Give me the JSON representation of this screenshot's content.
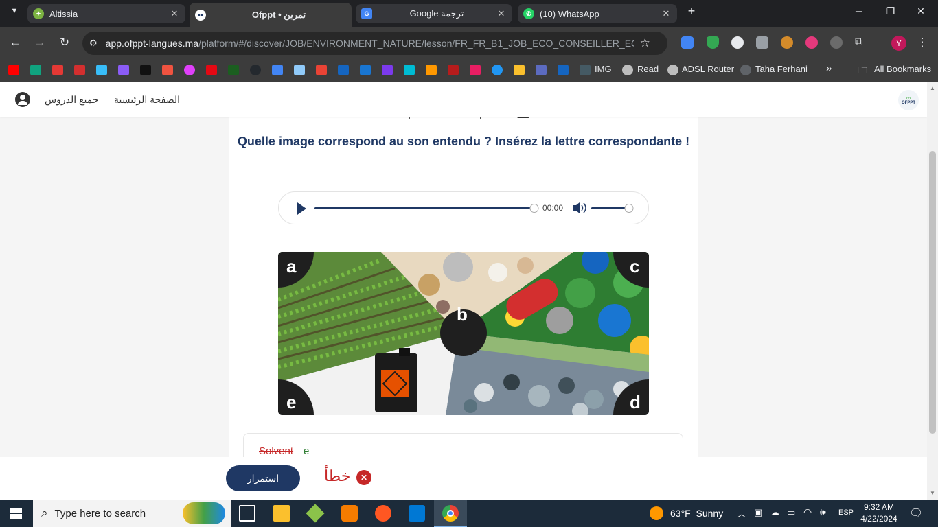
{
  "tabs": [
    {
      "title": "Altissia",
      "active": false
    },
    {
      "title": "Ofppt • تمرين",
      "active": true
    },
    {
      "title": "Google ترجمة",
      "active": false
    },
    {
      "title": "(10) WhatsApp",
      "active": false
    }
  ],
  "toolbar": {
    "url_domain": "app.ofppt-langues.ma",
    "url_path": "/platform/#/discover/JOB/ENVIRONMENT_NATURE/lesson/FR_FR_B1_JOB_ECO_CONSEILLER_ECO_CO..."
  },
  "bookmarks": {
    "labels": [
      "IMG",
      "Read",
      "ADSL Router",
      "Taha Ferhani"
    ],
    "all_bookmarks": "All Bookmarks",
    "more": "»"
  },
  "profile_initial": "Y",
  "site": {
    "nav_all_lessons": "جميع الدروس",
    "nav_home": "الصفحة الرئيسية",
    "logo_text": "OFPPT"
  },
  "exercise": {
    "instruction_partial": "Tapez la bonne réponse.",
    "question": "Quelle image correspond au son entendu ? Insérez la lettre correspondante !",
    "audio_time": "00:00",
    "audio_progress": 1.0,
    "volume_level": 1.0,
    "image_letters": [
      "a",
      "b",
      "c",
      "d",
      "e"
    ],
    "answer_wrong": "Solvent",
    "answer_correct": "e"
  },
  "footer": {
    "status": "خطأ",
    "continue_label": "استمرار"
  },
  "taskbar": {
    "search_placeholder": "Type here to search",
    "weather": "63°F  Sunny",
    "language": "ESP",
    "time": "9:32 AM",
    "date": "4/22/2024"
  },
  "colors": {
    "primary": "#1f3864",
    "error": "#c62828",
    "correct": "#2e7d32"
  }
}
